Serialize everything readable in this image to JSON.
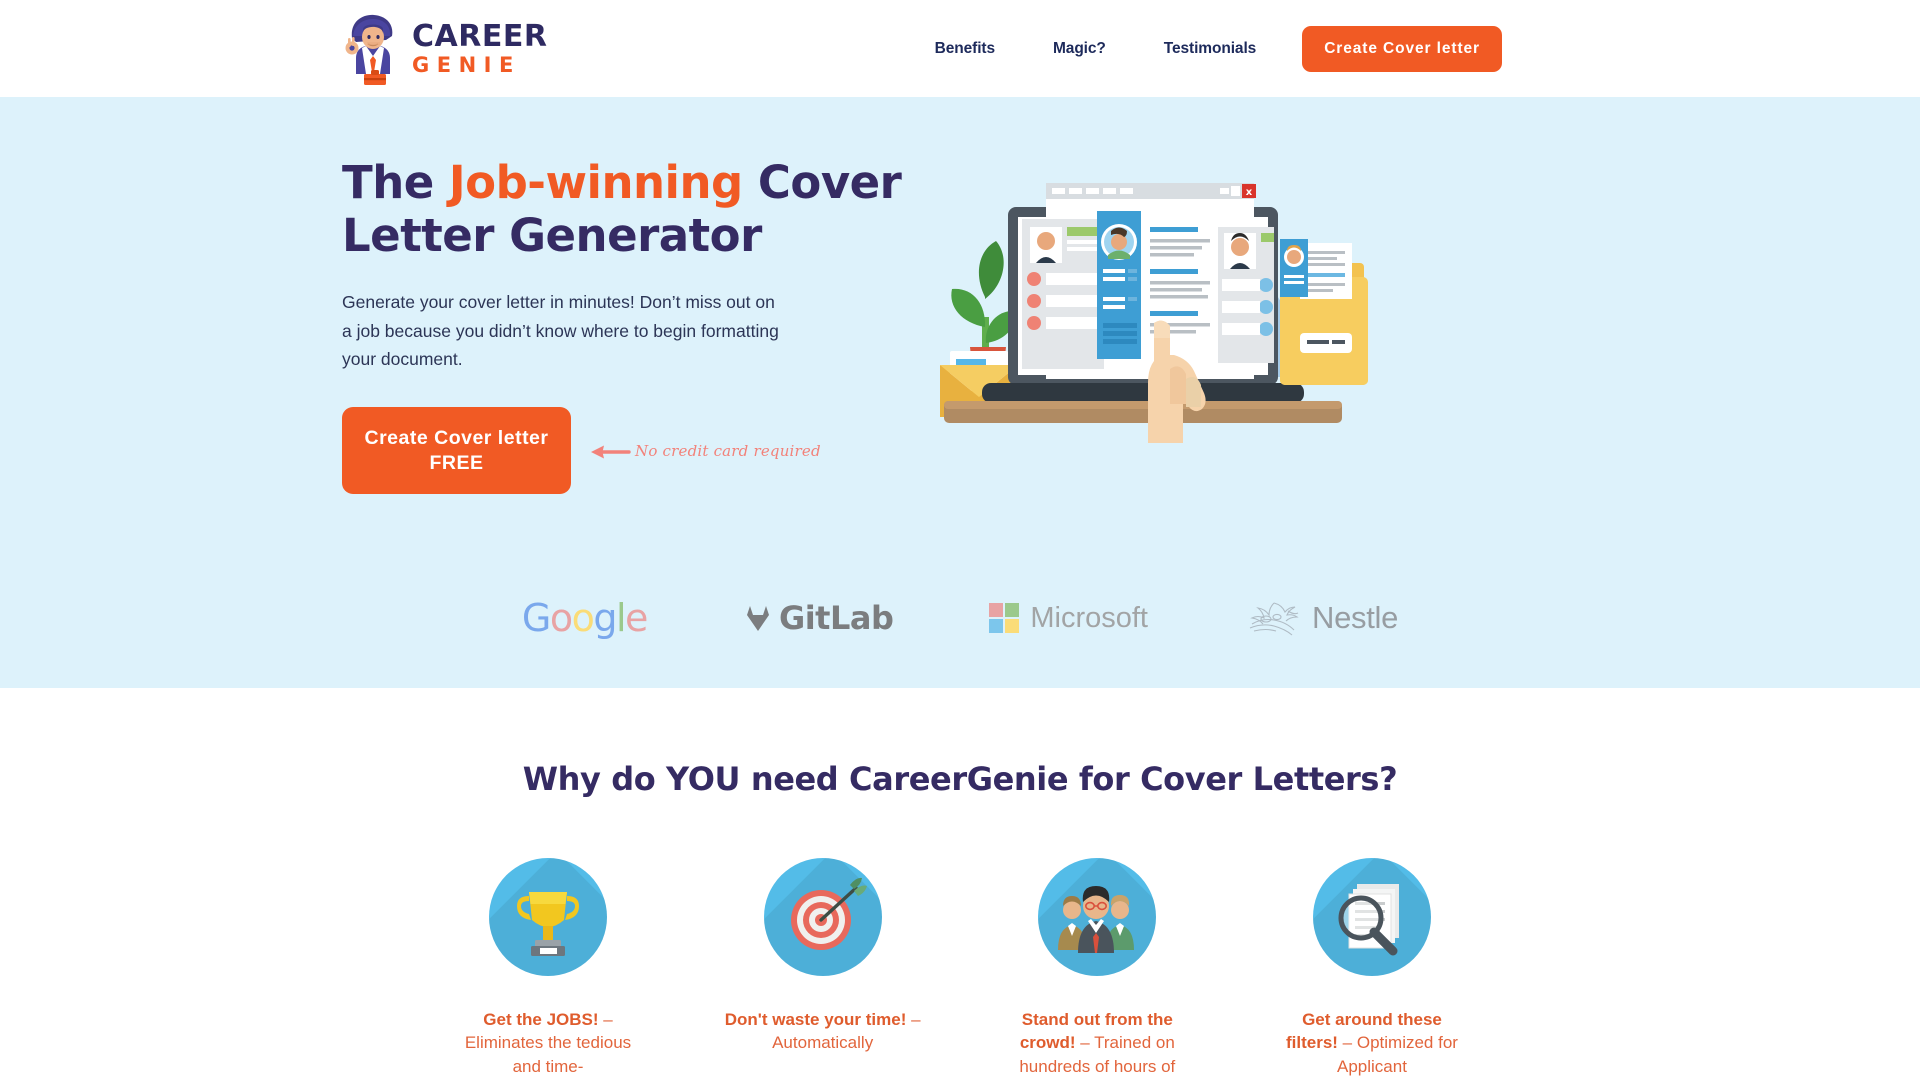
{
  "header": {
    "logo": {
      "name": "careergenie-logo",
      "top_text": "CAREER",
      "bottom_text": "GENIE"
    },
    "nav": [
      {
        "label": "Benefits",
        "name": "nav-benefits"
      },
      {
        "label": "Magic?",
        "name": "nav-magic"
      },
      {
        "label": "Testimonials",
        "name": "nav-testimonials"
      }
    ],
    "cta_label": "Create Cover letter"
  },
  "hero": {
    "title_part1": "The ",
    "title_accent": "Job-winning",
    "title_part2": "  Cover Letter Generator",
    "subtitle": "Generate your cover letter in minutes! Don’t miss out on a job because you didn’t know where to begin formatting your document.",
    "cta_line1": "Create Cover letter",
    "cta_line2": "FREE",
    "note": "No credit card required",
    "note_color": "#f2827a",
    "background_color": "#ddf2fb",
    "illustration_name": "cover-letter-laptop-illustration"
  },
  "brands": [
    {
      "name": "google-logo",
      "label": "Google"
    },
    {
      "name": "gitlab-logo",
      "label": "GitLab"
    },
    {
      "name": "microsoft-logo",
      "label": "Microsoft"
    },
    {
      "name": "nestle-logo",
      "label": "Nestle"
    }
  ],
  "benefits": {
    "heading": "Why do YOU need CareerGenie for Cover Letters?",
    "cards": [
      {
        "icon": "trophy-icon",
        "bold": "Get the JOBS!",
        "rest": "  – Eliminates the tedious and time-"
      },
      {
        "icon": "target-arrow-icon",
        "bold": "Don't waste your time!",
        "rest": "  – Automatically"
      },
      {
        "icon": "people-group-icon",
        "bold": "Stand out from the crowd!",
        "rest": "  – Trained on hundreds of hours of"
      },
      {
        "icon": "document-search-icon",
        "bold": "Get around these filters!",
        "rest": "  – Optimized for Applicant"
      }
    ]
  },
  "theme": {
    "accent_orange": "#f15a24",
    "deep_purple": "#352b63",
    "navy": "#1d2a5b",
    "hero_blue": "#ddf2fb",
    "icon_blue": "#53bce8"
  }
}
